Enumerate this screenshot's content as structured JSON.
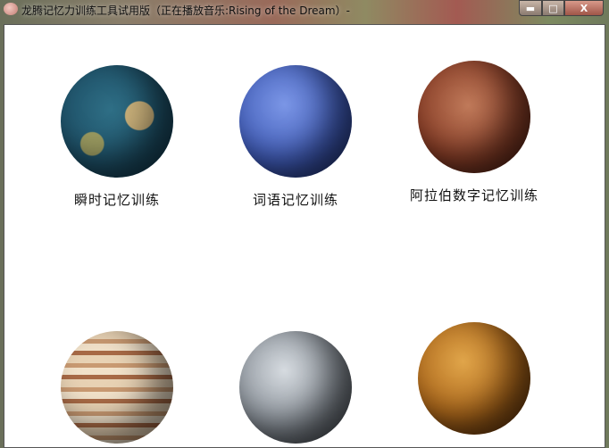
{
  "window": {
    "title": "龙腾记忆力训练工具试用版（正在播放音乐:Rising of the Dream）-",
    "minimize": "▬",
    "maximize": "□",
    "close": "X"
  },
  "modules": [
    {
      "label": "瞬时记忆训练",
      "planet": "earth"
    },
    {
      "label": "词语记忆训练",
      "planet": "neptune"
    },
    {
      "label": "阿拉伯数字记忆训练",
      "planet": "mars"
    },
    {
      "label": "",
      "planet": "jupiter"
    },
    {
      "label": "",
      "planet": "pluto"
    },
    {
      "label": "",
      "planet": "venus"
    }
  ]
}
